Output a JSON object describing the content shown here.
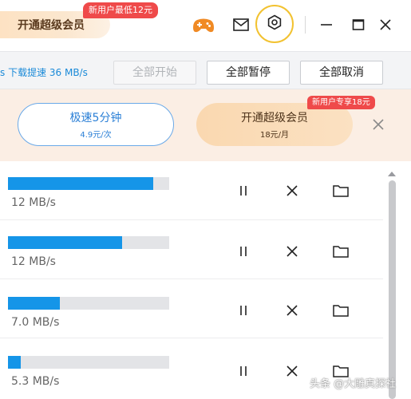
{
  "titlebar": {
    "vip_label": "开通超级会员",
    "promo_tag": "新用户最低12元",
    "icons": [
      "game-icon",
      "mail-icon",
      "settings-icon",
      "minimize-icon",
      "maximize-icon",
      "close-icon"
    ]
  },
  "toolbar": {
    "speed_text": "s  下载提速 36 MB/s",
    "start_all": "全部开始",
    "pause_all": "全部暂停",
    "cancel_all": "全部取消"
  },
  "banner": {
    "speed_title": "极速5分钟",
    "speed_price": "4.9元/次",
    "vip_title": "开通超级会员",
    "vip_price": "18元/月",
    "vip_tag": "新用户专享18元"
  },
  "downloads": [
    {
      "speed": "12 MB/s",
      "progress": 0.9
    },
    {
      "speed": "12 MB/s",
      "progress": 0.71
    },
    {
      "speed": "7.0 MB/s",
      "progress": 0.32
    },
    {
      "speed": "5.3 MB/s",
      "progress": 0.08
    }
  ],
  "watermark": "头条 @大雕真探社",
  "colors": {
    "accent_blue": "#1595e8",
    "promo_red": "#ef4a4a",
    "highlight_ring": "#f2c230",
    "banner_bg": "#fbeee4"
  }
}
